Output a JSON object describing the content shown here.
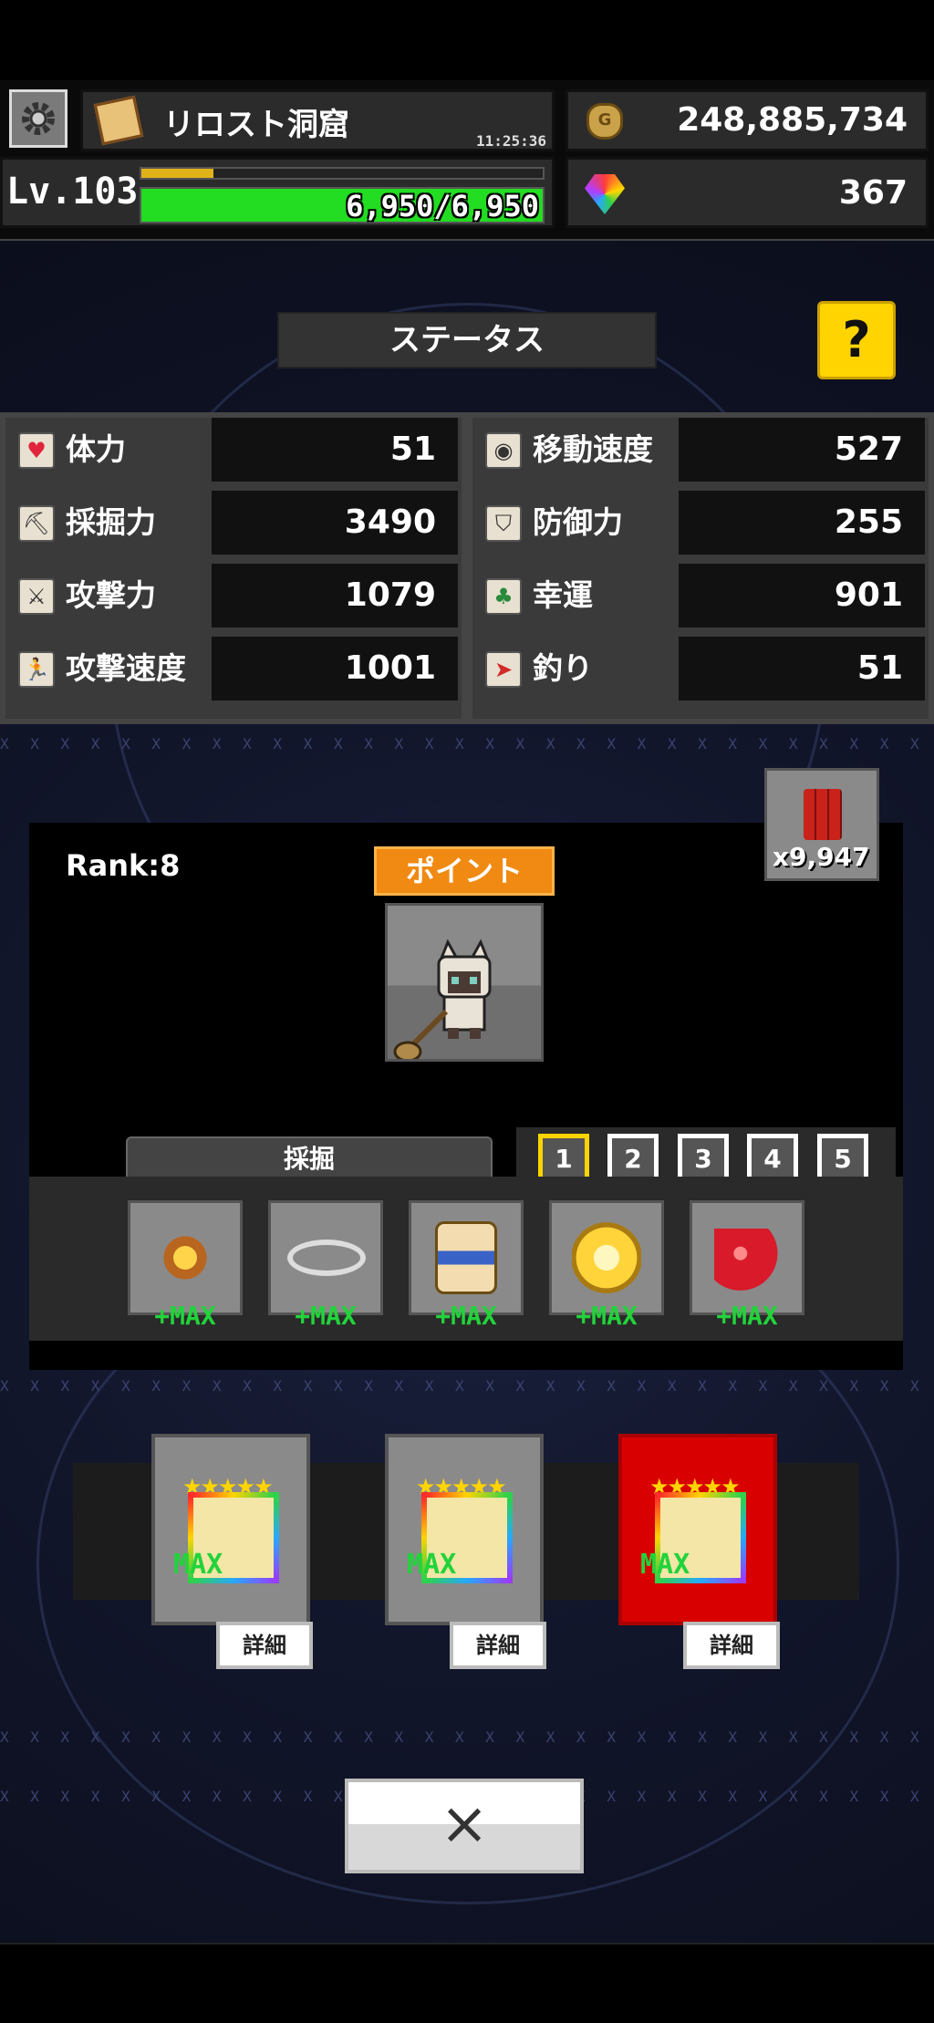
{
  "header": {
    "location_name": "リロスト洞窟",
    "time": "11:25:36",
    "gold": "248,885,734",
    "gems": "367",
    "level": "Lv.103",
    "hp": "6,950/6,950",
    "xp_fill": 0.18,
    "hp_fill": 1.0
  },
  "status": {
    "title": "ステータス",
    "help_label": "?",
    "left": [
      {
        "label": "体力",
        "value": "51",
        "icon": "heart-icon"
      },
      {
        "label": "採掘力",
        "value": "3490",
        "icon": "pickaxe-icon"
      },
      {
        "label": "攻撃力",
        "value": "1079",
        "icon": "sword-icon"
      },
      {
        "label": "攻撃速度",
        "value": "1001",
        "icon": "runner-icon"
      }
    ],
    "right": [
      {
        "label": "移動速度",
        "value": "527",
        "icon": "compass-icon"
      },
      {
        "label": "防御力",
        "value": "255",
        "icon": "shield-icon"
      },
      {
        "label": "幸運",
        "value": "901",
        "icon": "clover-icon"
      },
      {
        "label": "釣り",
        "value": "51",
        "icon": "fish-icon"
      }
    ]
  },
  "character": {
    "rank": "Rank:8",
    "point_button": "ポイント",
    "dynamite_count": "x9,947",
    "category_label": "採掘",
    "slots": [
      "1",
      "2",
      "3",
      "4",
      "5"
    ],
    "selected_slot": "1",
    "equipment": [
      {
        "icon": "compass-gem-icon",
        "max_label": "+MAX"
      },
      {
        "icon": "wing-necklace-icon",
        "max_label": "+MAX"
      },
      {
        "icon": "cake-bag-icon",
        "max_label": "+MAX"
      },
      {
        "icon": "golden-ring-icon",
        "max_label": "+MAX"
      },
      {
        "icon": "red-apple-icon",
        "max_label": "+MAX"
      }
    ]
  },
  "tools": [
    {
      "icon": "shovel-icon",
      "max_label": "MAX",
      "detail_label": "詳細",
      "bg": "#8a8a8a"
    },
    {
      "icon": "log-icon",
      "max_label": "MAX",
      "detail_label": "詳細",
      "bg": "#8a8a8a"
    },
    {
      "icon": "shovel-icon",
      "max_label": "MAX",
      "detail_label": "詳細",
      "bg": "#d80000"
    }
  ],
  "close_label": "×",
  "colors": {
    "accent_orange": "#f08a12",
    "help_yellow": "#ffd400",
    "hp_green": "#22dd22",
    "max_green": "#22d33a",
    "selected_red": "#d80000"
  }
}
